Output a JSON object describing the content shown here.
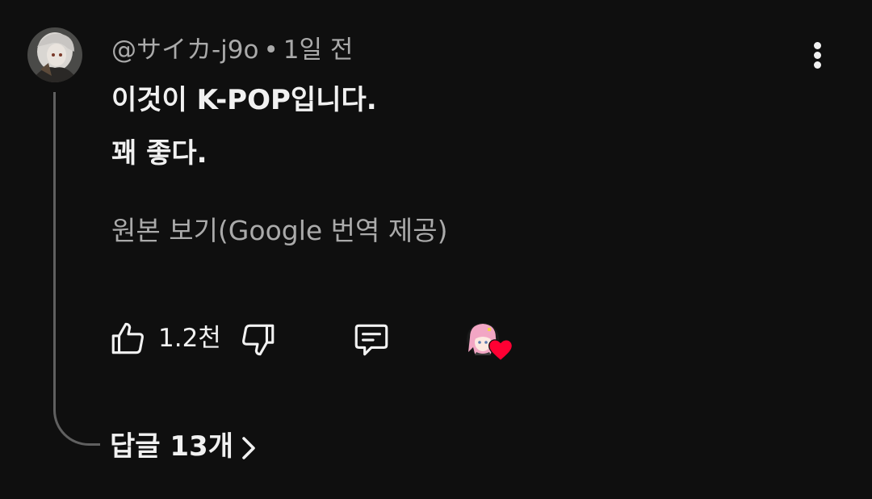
{
  "comment": {
    "author": "@サイカ-j9o",
    "separator": "•",
    "time": "1일 전",
    "lines": [
      "이것이 K-POP입니다.",
      "꽤 좋다."
    ],
    "see_original": "원본 보기(Google 번역 제공)"
  },
  "actions": {
    "like_count": "1.2천"
  },
  "replies": {
    "label": "답글 13개"
  },
  "icons": {
    "like": "thumbs-up-icon",
    "dislike": "thumbs-down-icon",
    "reply": "comment-icon",
    "more": "more-vert-icon",
    "heart": "creator-heart-icon",
    "chevron": "chevron-right-icon"
  },
  "colors": {
    "background": "#0f0f0f",
    "primary_text": "#f1f1f1",
    "secondary_text": "#aaaaaa",
    "thread_line": "#606060",
    "heart": "#ff0033"
  }
}
